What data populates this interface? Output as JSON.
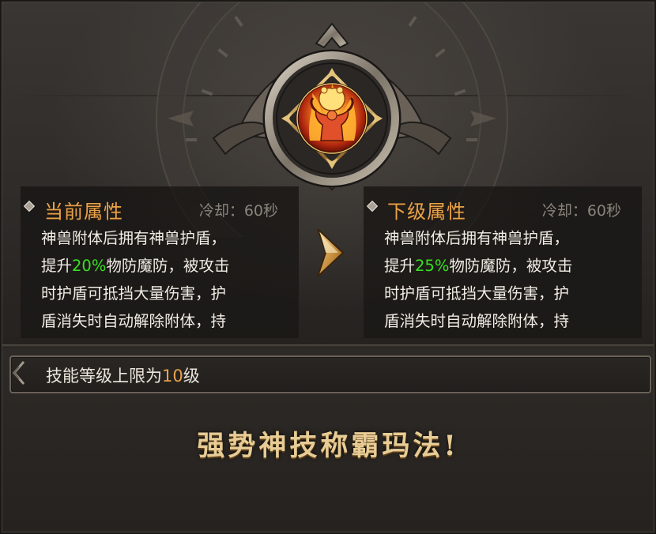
{
  "current": {
    "title": "当前属性",
    "cooldown": "冷却：60秒",
    "line1": "神兽附体后拥有神兽护盾，",
    "line2_pre": "提升",
    "line2_pct": "20%",
    "line2_post": "物防魔防，被攻击",
    "line3": "时护盾可抵挡大量伤害，护",
    "line4": "盾消失时自动解除附体，持"
  },
  "next": {
    "title": "下级属性",
    "cooldown": "冷却：60秒",
    "line1": "神兽附体后拥有神兽护盾，",
    "line2_pre": "提升",
    "line2_pct": "25%",
    "line2_post": "物防魔防，被攻击",
    "line3": "时护盾可抵挡大量伤害，护",
    "line4": "盾消失时自动解除附体，持"
  },
  "level": {
    "pre": "技能等级上限为",
    "value": "10",
    "post": "级"
  },
  "slogan": "强势神技称霸玛法!",
  "colors": {
    "title_orange": "#e8a24a",
    "percent_green": "#38e021",
    "body_text": "#f1ece4",
    "cooldown_gray": "#8a847c",
    "slogan_gold": "#e7cc95"
  },
  "icons": {
    "skill": "flame-beast-warrior-icon",
    "arrow": "chevron-right-icon",
    "bullet": "diamond-bullet-icon"
  }
}
